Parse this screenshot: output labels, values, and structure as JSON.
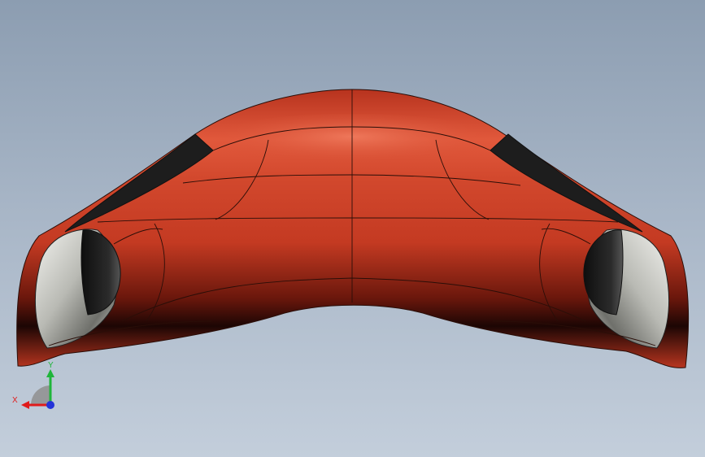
{
  "viewport": {
    "background_top": "#8c9db1",
    "background_bottom": "#c3cedb"
  },
  "model": {
    "body_color": "#c83b23",
    "window_color": "#1e1e1e",
    "headlight_color": "#d9dad5",
    "edge_color": "#2a0e08"
  },
  "triad": {
    "x_label": "X",
    "y_label": "Y",
    "x_color": "#e01b1b",
    "y_color": "#1fb53a",
    "z_color": "#2433d8"
  }
}
